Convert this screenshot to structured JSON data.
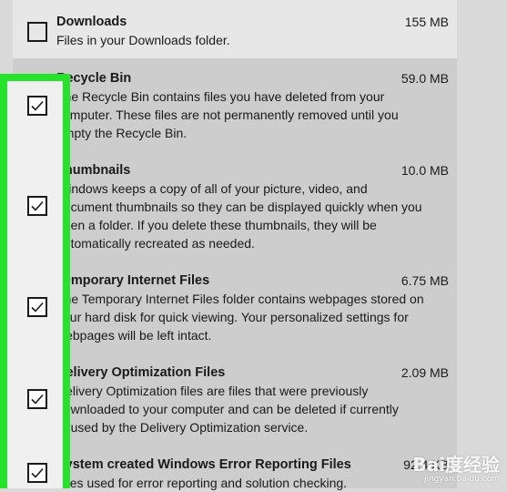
{
  "items": [
    {
      "title": "Downloads",
      "size": "155 MB",
      "checked": false,
      "desc_lines": [
        "Files in your Downloads folder."
      ]
    },
    {
      "title": "Recycle Bin",
      "size": "59.0 MB",
      "checked": true,
      "desc_lines": [
        "The Recycle Bin contains files you have deleted from your",
        "computer. These files are not permanently removed until you",
        "empty the Recycle Bin."
      ]
    },
    {
      "title": "Thumbnails",
      "size": "10.0 MB",
      "checked": true,
      "desc_lines": [
        "Windows keeps a copy of all of your picture, video, and",
        "document thumbnails so they can be displayed quickly when you",
        "open a folder. If you delete these thumbnails, they will be",
        "automatically recreated as needed."
      ]
    },
    {
      "title": "Temporary Internet Files",
      "size": "6.75 MB",
      "checked": true,
      "desc_lines": [
        "The Temporary Internet Files folder contains webpages stored on",
        "your hard disk for quick viewing. Your personalized settings for",
        "webpages will be left intact."
      ]
    },
    {
      "title": "Delivery Optimization Files",
      "size": "2.09 MB",
      "checked": true,
      "desc_lines": [
        "Delivery Optimization files are files that were previously",
        "downloaded to your computer and can be deleted if currently",
        "unused by the Delivery Optimization service."
      ]
    },
    {
      "title": "System created Windows Error Reporting Files",
      "size": "92.4 KB",
      "checked": true,
      "desc_lines": [
        "Files used for error reporting and solution checking."
      ]
    }
  ],
  "watermark": {
    "main": "Bai度经验",
    "sub": "jingyan.baidu.com"
  },
  "colors": {
    "highlight": "#27e22b",
    "selected_bg": "#cdcdcd",
    "panel_bg": "#e7e7e7"
  }
}
